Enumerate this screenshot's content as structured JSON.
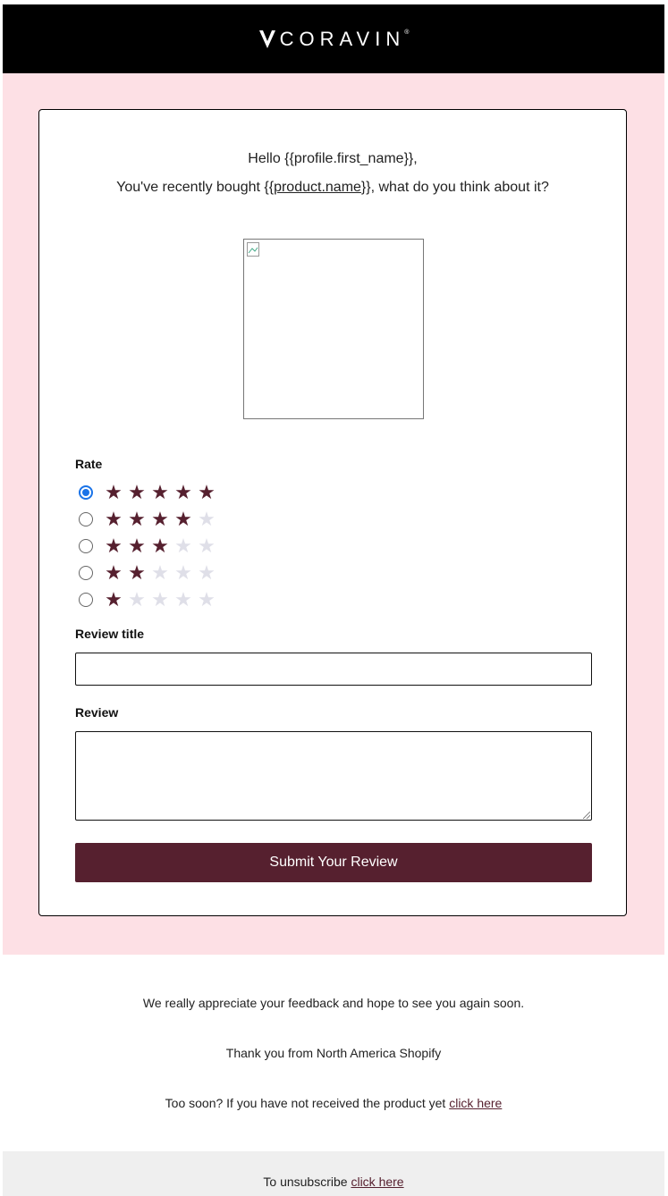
{
  "brand": {
    "logo_text": "CORAVIN",
    "logo_mark": "V",
    "registered": "®"
  },
  "intro": {
    "hello": "Hello {{profile.first_name}},",
    "bought_prefix": "You've recently bought {{",
    "product_link": "product.name",
    "bought_suffix": "}}, what do you think about it?"
  },
  "form": {
    "rate_label": "Rate",
    "ratings": [
      5,
      4,
      3,
      2,
      1
    ],
    "selected_rating": 5,
    "review_title_label": "Review title",
    "review_title_value": "",
    "review_label": "Review",
    "review_value": "",
    "submit_label": "Submit Your Review"
  },
  "footer": {
    "appreciate": "We really appreciate your feedback and hope to see you again soon.",
    "thanks": "Thank you from North America Shopify",
    "too_soon_text": "Too soon? If you have not received the product yet",
    "too_soon_link": "click here",
    "unsubscribe_text": "To unsubscribe",
    "unsubscribe_link": "click here"
  },
  "colors": {
    "header_bg": "#000000",
    "page_bg": "#fde0e5",
    "accent": "#56202f",
    "star_empty": "#dfdfe8",
    "radio_checked": "#1a73e8"
  }
}
